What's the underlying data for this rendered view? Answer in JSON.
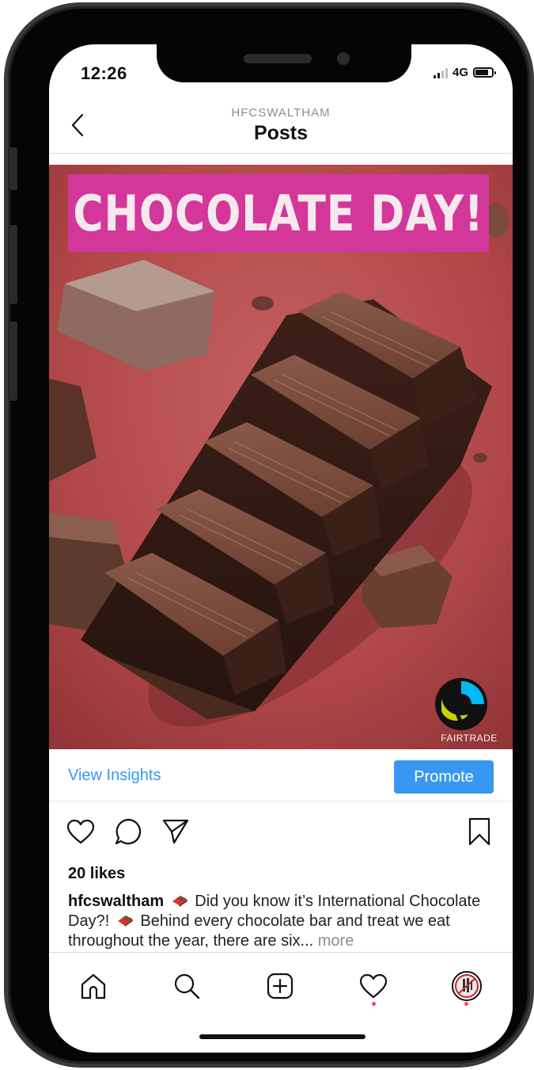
{
  "status_bar": {
    "time": "12:26",
    "network": "4G"
  },
  "header": {
    "account": "HFCSWALTHAM",
    "title": "Posts"
  },
  "post": {
    "banner_text": "CHOCOLATE DAY!",
    "logo_label": "FAIRTRADE"
  },
  "insights": {
    "view_label": "View Insights",
    "promote_label": "Promote"
  },
  "likes": "20 likes",
  "caption": {
    "username": "hfcswaltham",
    "part1": "Did you know it’s International Chocolate Day?!",
    "part2": "Behind every chocolate bar and treat we eat throughout the year, there are six...",
    "more": "more"
  },
  "icons": {
    "back": "chevron-left-icon",
    "like": "heart-icon",
    "comment": "comment-icon",
    "share": "send-icon",
    "save": "bookmark-icon",
    "tab_home": "home-icon",
    "tab_search": "search-icon",
    "tab_add": "add-post-icon",
    "tab_activity": "heart-icon",
    "tab_profile": "avatar"
  },
  "colors": {
    "accent": "#3897f0",
    "banner": "#d3379a",
    "notification_dot": "#ed4956",
    "background_red": "#b84a4c"
  }
}
